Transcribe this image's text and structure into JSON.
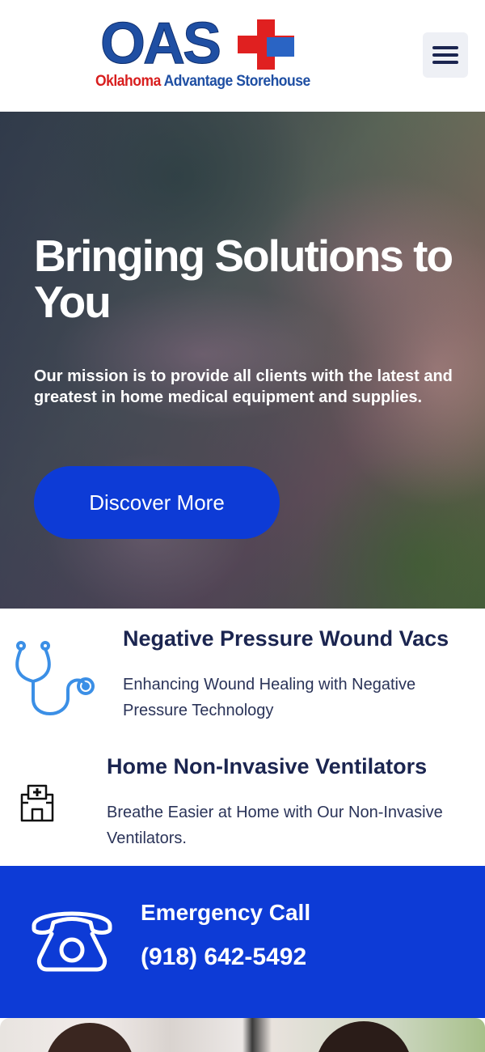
{
  "header": {
    "logo_main": "OAS",
    "logo_sub_red": "Oklahoma",
    "logo_sub_blue": " Advantage Storehouse",
    "menu_icon": "hamburger-menu-icon"
  },
  "hero": {
    "title": "Bringing Solutions to You",
    "text": "Our mission is to provide all clients with the latest and greatest in home medical equipment and supplies.",
    "button_label": "Discover More"
  },
  "services": [
    {
      "icon": "stethoscope-icon",
      "title": "Negative Pressure Wound Vacs",
      "text": "Enhancing Wound Healing with Negative Pressure Technology"
    },
    {
      "icon": "hospital-icon",
      "title": "Home Non-Invasive Ventilators",
      "text": "Breathe Easier at Home with Our Non-Invasive Ventilators."
    }
  ],
  "emergency": {
    "icon": "telephone-icon",
    "title": "Emergency Call",
    "phone": "(918) 642-5492"
  },
  "colors": {
    "brand_blue": "#0d3bd6",
    "navy_text": "#1b2550",
    "icon_blue": "#3b8fe6",
    "logo_red": "#d81e1e"
  }
}
